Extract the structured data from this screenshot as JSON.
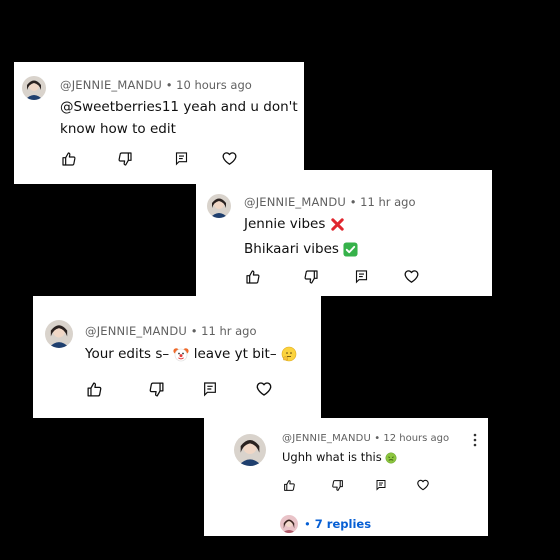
{
  "comments": [
    {
      "handle": "@JENNIE_MANDU",
      "sep": "•",
      "time": "10 hours ago",
      "lines": [
        "@Sweetberries11 yeah and u don't",
        "know how to edit"
      ]
    },
    {
      "handle": "@JENNIE_MANDU",
      "sep": "•",
      "time": "11 hr ago",
      "lines": [
        "Jennie vibes",
        "Bhikaari vibes"
      ],
      "emojis": [
        "cross-mark",
        "check-mark"
      ]
    },
    {
      "handle": "@JENNIE_MANDU",
      "sep": "•",
      "time": "11 hr ago",
      "text_a": "Your edits s–",
      "text_b": "leave yt bit–",
      "emojis": [
        "clown-face",
        "peeking-face"
      ]
    },
    {
      "handle": "@JENNIE_MANDU",
      "sep": "•",
      "time": "12 hours ago",
      "text": "Ughh what is this",
      "emojis": [
        "nauseated-face"
      ],
      "replies_label": "7 replies",
      "replies_prefix": "•"
    }
  ],
  "colors": {
    "link": "#065fd4",
    "meta": "#606060",
    "text": "#0f0f0f",
    "background": "#000000"
  }
}
